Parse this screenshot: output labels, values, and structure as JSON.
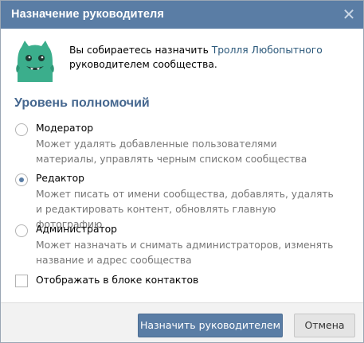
{
  "dialog": {
    "title": "Назначение руководителя",
    "close_glyph": "✕"
  },
  "intro": {
    "prefix": "Вы собираетесь назначить ",
    "link": "Тролля Любопытного",
    "suffix": "руководителем сообщества."
  },
  "avatar_icon": "green-monster-avatar",
  "permissions": {
    "heading": "Уровень полномочий",
    "options": [
      {
        "label": "Модератор",
        "description": "Может удалять добавленные пользователями материалы, управлять черным списком сообщества",
        "checked": false
      },
      {
        "label": "Редактор",
        "description": "Может писать от имени сообщества, добавлять, удалять и редактировать контент, обновлять главную фотографию",
        "checked": true
      },
      {
        "label": "Администратор",
        "description": "Может назначать и снимать администраторов, изменять название и адрес сообщества",
        "checked": false
      }
    ]
  },
  "show_in_contacts": {
    "label": "Отображать в блоке контактов",
    "checked": false
  },
  "footer": {
    "primary_label": "Назначить руководителем",
    "cancel_label": "Отмена"
  },
  "colors": {
    "header": "#5a7da5",
    "section_title": "#45678f",
    "link": "#2b587a",
    "avatar_green": "#3bae8c"
  }
}
